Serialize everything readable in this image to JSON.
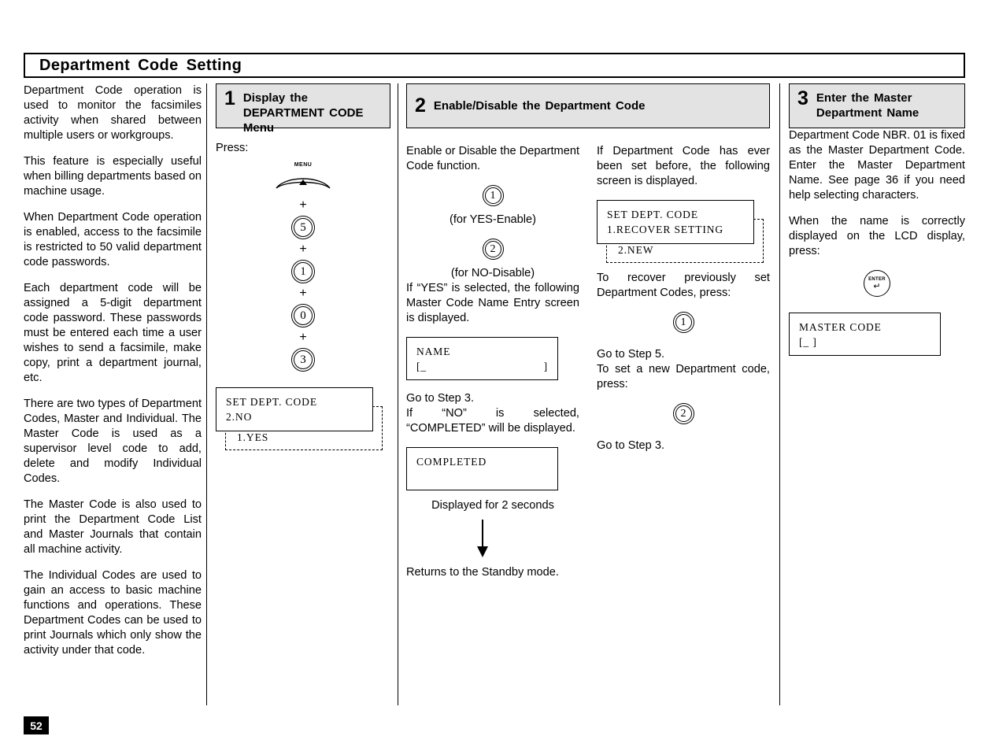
{
  "page": {
    "title": "Department Code Setting",
    "page_number": "52"
  },
  "intro": {
    "paragraphs": [
      "Department Code operation is used to monitor the facsimiles activity when shared between multiple users or workgroups.",
      "This feature is especially useful when billing departments based on machine usage.",
      "When Department Code operation is enabled, access to the facsimile is restricted to 50 valid department code passwords.",
      "Each department code will be assigned a 5-digit department code password. These passwords must be entered each time a user wishes to send a facsimile, make copy, print a department journal, etc.",
      "There are two types of Department Codes, Master and Individual. The Master Code is used as a supervisor level code to add, delete and modify Individual Codes.",
      "The Master Code is also used to print the Department Code List and Master Journals that contain all machine activity.",
      "The Individual Codes are used to gain an access to basic machine functions and operations. These Department Codes can be used to print Journals which only show the activity under that code."
    ]
  },
  "step1": {
    "number": "1",
    "title": "Display the DEPARTMENT CODE Menu",
    "press_label": "Press:",
    "menu_key_label": "MENU",
    "menu_key_glyph": "▲",
    "keys": [
      "5",
      "1",
      "0",
      "3"
    ],
    "plus": "+",
    "lcd": {
      "line1": "SET DEPT. CODE",
      "line2": "2.NO",
      "ghost_line": "1.YES"
    }
  },
  "step2": {
    "number": "2",
    "title": "Enable/Disable the Department Code",
    "left": {
      "intro": "Enable or Disable the Department Code function.",
      "key_yes": "1",
      "key_yes_caption": "(for YES-Enable)",
      "key_no": "2",
      "key_no_caption": "(for NO-Disable)",
      "yes_text": "If “YES” is selected, the following Master Code Name Entry screen is displayed.",
      "name_lcd": {
        "line1": "NAME",
        "line2_open": "[_",
        "line2_close": "]"
      },
      "goto_step3": "Go to Step 3.",
      "no_text": "If “NO” is selected, “COMPLETED” will be displayed.",
      "completed_lcd": {
        "line1": "COMPLETED"
      },
      "displayed_caption": "Displayed for 2 seconds",
      "standby_text": "Returns to the Standby mode."
    },
    "right": {
      "intro": "If Department Code has ever been set before, the following screen is displayed.",
      "lcd": {
        "line1": "SET DEPT. CODE",
        "line2": "1.RECOVER SETTING",
        "ghost_line": "2.NEW"
      },
      "recover_text": "To recover previously set Department Codes, press:",
      "recover_key": "1",
      "goto_step5": "Go to Step 5.",
      "new_text": "To set a new Department code, press:",
      "new_key": "2",
      "goto_step3": "Go to Step 3."
    }
  },
  "step3": {
    "number": "3",
    "title": "Enter the Master Department Name",
    "paragraph1": "Department Code NBR. 01 is fixed as the Master Department Code. Enter the Master Department Name. See page 36 if you need help selecting characters.",
    "paragraph2": "When the name is correctly displayed on the LCD display, press:",
    "enter_key_label": "ENTER",
    "enter_key_glyph": "↵",
    "lcd": {
      "line1": "MASTER CODE",
      "line2": "[_      ]"
    }
  }
}
